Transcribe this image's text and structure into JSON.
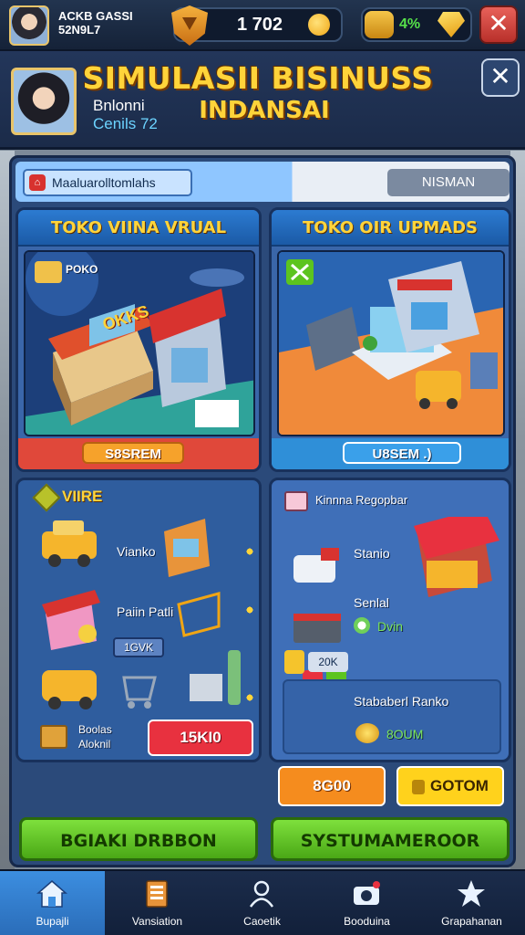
{
  "topbar": {
    "player_name": "ACKB GASSI 52N9L7",
    "coins": "1 702",
    "gems": "4%",
    "close_icon": "close-icon"
  },
  "header": {
    "title_line1": "SIMULASII BISINUSS",
    "title_line2": "INDANSAI",
    "player_line1": "Bnlonni",
    "player_line2": "Cenils 72"
  },
  "tabs": {
    "left_label": "Maaluarolltomlahs",
    "right_label": "NISMAN"
  },
  "cards": {
    "virtual_store": {
      "title": "TOKO VIINA VRUAL",
      "sign": "OKKS",
      "tag": "POKO",
      "button": "S8SREM"
    },
    "upgrade_store": {
      "title": "TOKO OIR UPMADS",
      "button": "U8SEM .)"
    },
    "vehicles": {
      "header": "VIIRE",
      "item1": "Vianko",
      "item2": "Paiin Patli",
      "badge": "1GVK",
      "footer_line1": "Boolas",
      "footer_line2": "Aloknil",
      "price": "15KI0"
    },
    "shop_items": {
      "header": "Kinnna Regopbar",
      "item1": "Stanio",
      "item2": "Senlal",
      "item2_value": "Dvin",
      "badge": "20K",
      "item3": "Stababerl Ranko",
      "item3_value": "8OUM",
      "btn_orange": "8G00",
      "btn_yellow": "GOTOM"
    }
  },
  "actions": {
    "left": "BGIAKI DRBBON",
    "right": "SYSTUMAMEROOR"
  },
  "nav": [
    {
      "label": "Bupajli",
      "icon": "home-icon"
    },
    {
      "label": "Vansiation",
      "icon": "ledger-icon"
    },
    {
      "label": "Caoetik",
      "icon": "person-icon"
    },
    {
      "label": "Booduina",
      "icon": "camera-icon"
    },
    {
      "label": "Grapahanan",
      "icon": "star-gear-icon"
    }
  ],
  "colors": {
    "title_yellow": "#ffd43a",
    "green_button": "#5cc41f",
    "red_button": "#e8313f",
    "orange_button": "#f58c1e",
    "yellow_button": "#ffd21c",
    "panel_blue": "#3a66a9"
  }
}
